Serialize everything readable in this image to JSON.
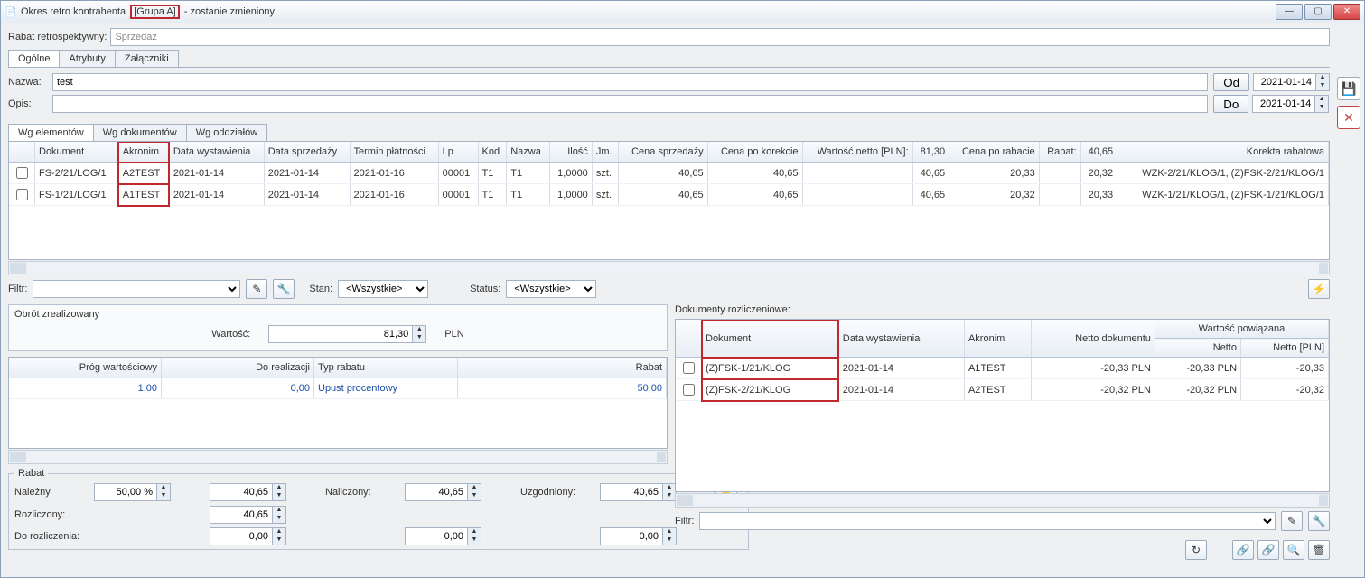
{
  "window": {
    "title_pre": "Okres retro kontrahenta",
    "title_highlight": "[Grupa A]",
    "title_post": "- zostanie zmieniony"
  },
  "rabat_retro": {
    "label": "Rabat retrospektywny:",
    "value": "Sprzedaż"
  },
  "tabs_top": [
    "Ogólne",
    "Atrybuty",
    "Załączniki"
  ],
  "name_lbl": "Nazwa:",
  "name_val": "test",
  "desc_lbl": "Opis:",
  "desc_val": "",
  "od_btn": "Od",
  "do_btn": "Do",
  "od_date": "2021-01-14",
  "do_date": "2021-01-14",
  "subtabs": [
    "Wg elementów",
    "Wg dokumentów",
    "Wg oddziałów"
  ],
  "cols": [
    "",
    "Dokument",
    "Akronim",
    "Data wystawienia",
    "Data sprzedaży",
    "Termin płatności",
    "Lp",
    "Kod",
    "Nazwa",
    "Ilość",
    "Jm.",
    "Cena sprzedaży",
    "Cena po korekcie",
    "Wartość netto [PLN]:",
    "81,30",
    "Cena po rabacie",
    "Rabat:",
    "40,65",
    "Korekta rabatowa"
  ],
  "rows": [
    {
      "doc": "FS-2/21/LOG/1",
      "akr": "A2TEST",
      "dw": "2021-01-14",
      "ds": "2021-01-14",
      "tp": "2021-01-16",
      "lp": "00001",
      "kod": "T1",
      "nazwa": "T1",
      "ilosc": "1,0000",
      "jm": "szt.",
      "cs": "40,65",
      "ck": "40,65",
      "wn": "",
      "wn2": "40,65",
      "cr": "20,33",
      "rab": "",
      "rab2": "20,32",
      "kor": "WZK-2/21/KLOG/1, (Z)FSK-2/21/KLOG/1"
    },
    {
      "doc": "FS-1/21/LOG/1",
      "akr": "A1TEST",
      "dw": "2021-01-14",
      "ds": "2021-01-14",
      "tp": "2021-01-16",
      "lp": "00001",
      "kod": "T1",
      "nazwa": "T1",
      "ilosc": "1,0000",
      "jm": "szt.",
      "cs": "40,65",
      "ck": "40,65",
      "wn": "",
      "wn2": "40,65",
      "cr": "20,32",
      "rab": "",
      "rab2": "20,33",
      "kor": "WZK-1/21/KLOG/1, (Z)FSK-1/21/KLOG/1"
    }
  ],
  "filter_lbl": "Filtr:",
  "stan_lbl": "Stan:",
  "stan_val": "<Wszystkie>",
  "status_lbl": "Status:",
  "status_val": "<Wszystkie>",
  "obrot": {
    "legend": "Obrót zrealizowany",
    "wartosc_lbl": "Wartość:",
    "wartosc_val": "81,30",
    "waluta": "PLN"
  },
  "prog_cols": [
    "Próg wartościowy",
    "Do realizacji",
    "Typ rabatu",
    "Rabat"
  ],
  "prog_row": {
    "pw": "1,00",
    "dr": "0,00",
    "tr": "Upust procentowy",
    "rb": "50,00"
  },
  "rabat": {
    "legend": "Rabat",
    "nalezny": "Należny",
    "nalezny_pct": "50,00 %",
    "nalezny_val": "40,65",
    "naliczony": "Naliczony:",
    "naliczony_val": "40,65",
    "uzgodniony": "Uzgodniony:",
    "uzgodniony_val": "40,65",
    "rozliczony": "Rozliczony:",
    "rozliczony_val": "40,65",
    "do_rozl": "Do rozliczenia:",
    "do_rozl_val": "0,00",
    "nal2": "0,00",
    "uzg2": "0,00"
  },
  "dok_rozl": {
    "legend": "Dokumenty rozliczeniowe:",
    "cols_top": [
      "",
      "Dokument",
      "Data wystawienia",
      "Akronim",
      "Netto dokumentu",
      "Wartość powiązana"
    ],
    "cols_sub": [
      "Netto",
      "Netto [PLN]"
    ],
    "rows": [
      {
        "doc": "(Z)FSK-1/21/KLOG",
        "dw": "2021-01-14",
        "akr": "A1TEST",
        "nd": "-20,33 PLN",
        "n": "-20,33 PLN",
        "npln": "-20,33"
      },
      {
        "doc": "(Z)FSK-2/21/KLOG",
        "dw": "2021-01-14",
        "akr": "A2TEST",
        "nd": "-20,32 PLN",
        "n": "-20,32 PLN",
        "npln": "-20,32"
      }
    ],
    "filter_lbl": "Filtr:"
  }
}
